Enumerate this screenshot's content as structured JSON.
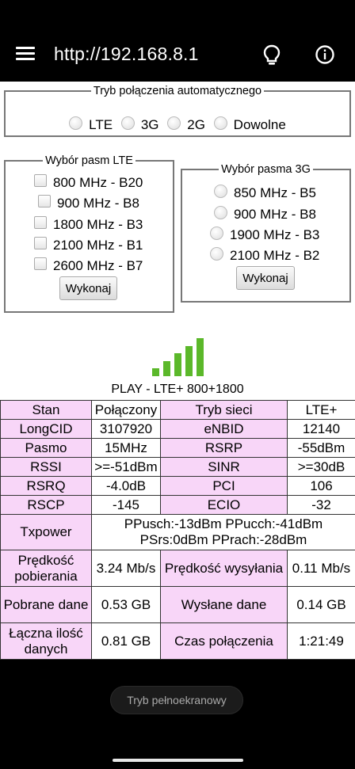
{
  "appbar": {
    "url": "http://192.168.8.1"
  },
  "mode": {
    "legend": "Tryb połączenia automatycznego",
    "options": [
      "LTE",
      "3G",
      "2G",
      "Dowolne"
    ]
  },
  "lte": {
    "legend": "Wybór pasm LTE",
    "bands": [
      "800 MHz - B20",
      "900 MHz - B8",
      "1800 MHz - B3",
      "2100 MHz - B1",
      "2600 MHz - B7"
    ],
    "button": "Wykonaj"
  },
  "umts": {
    "legend": "Wybór pasma 3G",
    "bands": [
      "850 MHz - B5",
      "900 MHz - B8",
      "1900 MHz - B3",
      "2100 MHz - B2"
    ],
    "button": "Wykonaj"
  },
  "signal": {
    "bars_active": 5,
    "bars_total": 5,
    "color": "#5bb82a"
  },
  "provider": "PLAY - LTE+ 800+1800",
  "table": {
    "r1": [
      "Stan",
      "Połączony",
      "Tryb sieci",
      "LTE+"
    ],
    "r2": [
      "LongCID",
      "3107920",
      "eNBID",
      "12140"
    ],
    "r3": [
      "Pasmo",
      "15MHz",
      "RSRP",
      "-55dBm"
    ],
    "r4": [
      "RSSI",
      ">=-51dBm",
      "SINR",
      ">=30dB"
    ],
    "r5": [
      "RSRQ",
      "-4.0dB",
      "PCI",
      "106"
    ],
    "r6": [
      "RSCP",
      "-145",
      "ECIO",
      "-32"
    ],
    "txpower": {
      "label": "Txpower",
      "line1": "PPusch:-13dBm PPucch:-41dBm",
      "line2": "PSrs:0dBm PPrach:-28dBm"
    },
    "r8": [
      "Prędkość pobierania",
      "3.24 Mb/s",
      "Prędkość wysyłania",
      "0.11 Mb/s"
    ],
    "r9": [
      "Pobrane dane",
      "0.53 GB",
      "Wysłane dane",
      "0.14 GB"
    ],
    "r10": [
      "Łączna ilość danych",
      "0.81 GB",
      "Czas połączenia",
      "1:21:49"
    ]
  },
  "bottom": {
    "fullscreen_label": "Tryb pełnoekranowy"
  }
}
